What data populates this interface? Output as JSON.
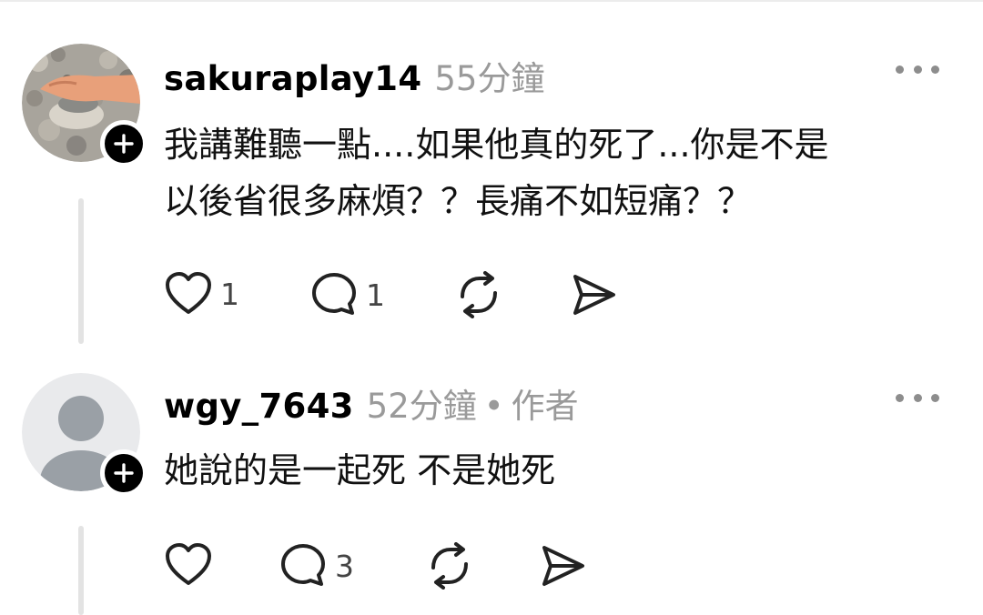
{
  "comments": [
    {
      "username": "sakuraplay14",
      "time": "55分鐘",
      "role": "",
      "text_line1": "我講難聽一點....如果他真的死了...你是不是",
      "text_line2": "以後省很多麻煩？？長痛不如短痛？？",
      "likes": "1",
      "replies": "1"
    },
    {
      "username": "wgy_7643",
      "time": "52分鐘",
      "separator": "•",
      "role": "作者",
      "text_line1": "她說的是一起死 不是她死",
      "likes": "",
      "replies": "3"
    }
  ],
  "icons": {
    "like": "heart-icon",
    "reply": "comment-bubble-icon",
    "repost": "repost-icon",
    "share": "send-icon",
    "more": "more-horizontal-icon",
    "follow": "plus-icon"
  },
  "colors": {
    "text": "#000000",
    "secondary": "#9a9a9a",
    "thread_line": "#e3e3e3"
  }
}
